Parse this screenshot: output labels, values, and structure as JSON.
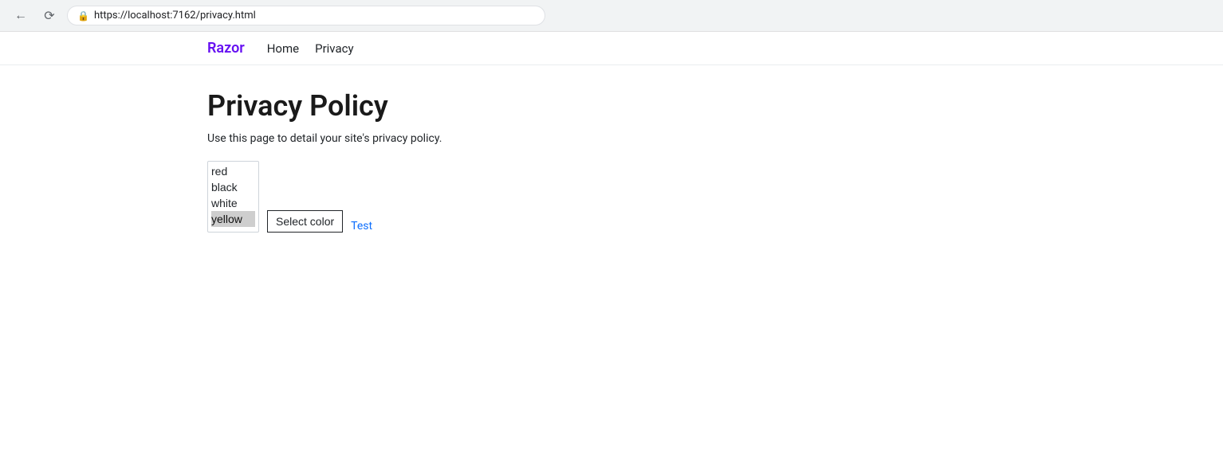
{
  "browser": {
    "url": "https://localhost:7162/privacy.html"
  },
  "navbar": {
    "brand": "Razor",
    "links": [
      {
        "label": "Home",
        "href": "#"
      },
      {
        "label": "Privacy",
        "href": "#"
      }
    ]
  },
  "main": {
    "title": "Privacy Policy",
    "subtitle": "Use this page to detail your site's privacy policy.",
    "select_label": "Select color",
    "test_link_label": "Test",
    "color_options": [
      {
        "value": "red",
        "label": "red"
      },
      {
        "value": "black",
        "label": "black"
      },
      {
        "value": "white",
        "label": "white"
      },
      {
        "value": "yellow",
        "label": "yellow"
      }
    ]
  }
}
